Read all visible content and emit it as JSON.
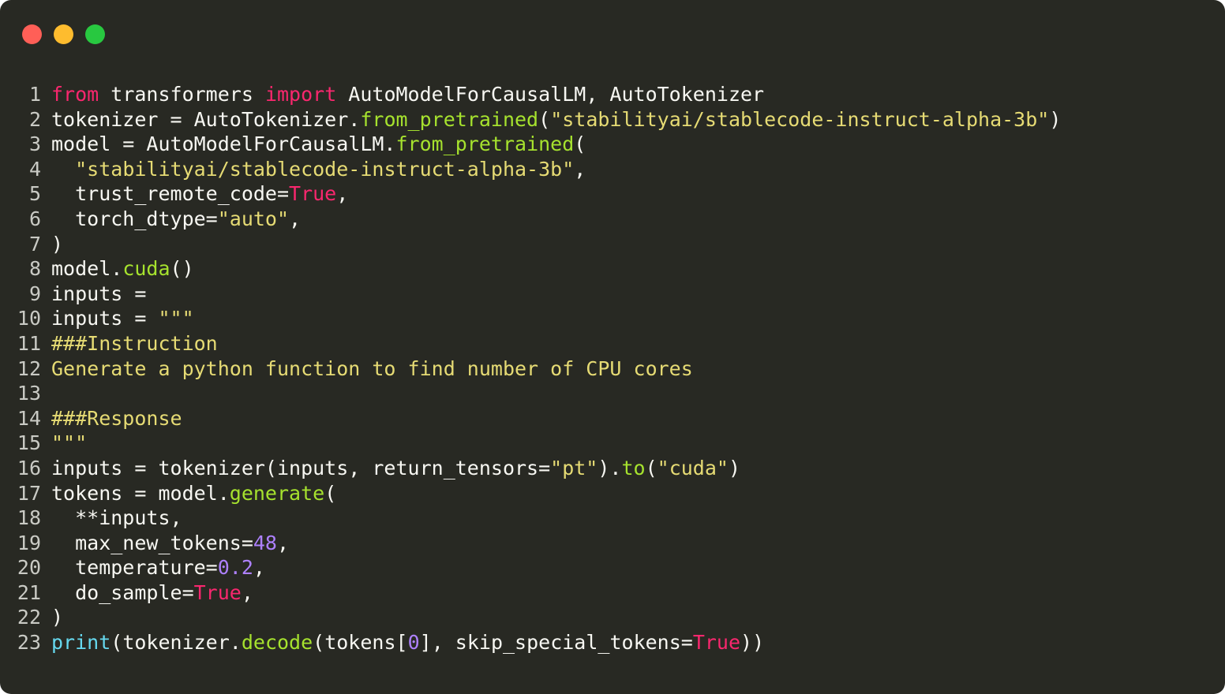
{
  "window": {
    "background_color": "#282923",
    "traffic_lights": [
      {
        "name": "close",
        "color": "#ff5f57"
      },
      {
        "name": "minimize",
        "color": "#febc2e"
      },
      {
        "name": "maximize",
        "color": "#28c840"
      }
    ]
  },
  "theme": {
    "name": "monokai",
    "text_color": "#f7f7f2",
    "gutter_color": "#c9cac4",
    "keyword_color": "#f9276e",
    "function_color": "#a6e22e",
    "string_color": "#e6db74",
    "number_color": "#ae81ff",
    "builtin_color": "#66d9ef"
  },
  "code": {
    "language": "python",
    "first_line_number": 1,
    "total_lines": 23,
    "lines": [
      {
        "n": "1",
        "tokens": [
          {
            "t": "from",
            "c": "kw"
          },
          {
            "t": " transformers ",
            "c": "plain"
          },
          {
            "t": "import",
            "c": "kw"
          },
          {
            "t": " AutoModelForCausalLM, AutoTokenizer",
            "c": "plain"
          }
        ]
      },
      {
        "n": "2",
        "tokens": [
          {
            "t": "tokenizer = AutoTokenizer.",
            "c": "plain"
          },
          {
            "t": "from_pretrained",
            "c": "fn"
          },
          {
            "t": "(",
            "c": "punct"
          },
          {
            "t": "\"stabilityai/stablecode-instruct-alpha-3b\"",
            "c": "str"
          },
          {
            "t": ")",
            "c": "punct"
          }
        ]
      },
      {
        "n": "3",
        "tokens": [
          {
            "t": "model = AutoModelForCausalLM.",
            "c": "plain"
          },
          {
            "t": "from_pretrained",
            "c": "fn"
          },
          {
            "t": "(",
            "c": "punct"
          }
        ]
      },
      {
        "n": "4",
        "tokens": [
          {
            "t": "  ",
            "c": "plain"
          },
          {
            "t": "\"stabilityai/stablecode-instruct-alpha-3b\"",
            "c": "str"
          },
          {
            "t": ",",
            "c": "punct"
          }
        ]
      },
      {
        "n": "5",
        "tokens": [
          {
            "t": "  trust_remote_code=",
            "c": "plain"
          },
          {
            "t": "True",
            "c": "kw"
          },
          {
            "t": ",",
            "c": "punct"
          }
        ]
      },
      {
        "n": "6",
        "tokens": [
          {
            "t": "  torch_dtype=",
            "c": "plain"
          },
          {
            "t": "\"auto\"",
            "c": "str"
          },
          {
            "t": ",",
            "c": "punct"
          }
        ]
      },
      {
        "n": "7",
        "tokens": [
          {
            "t": ")",
            "c": "punct"
          }
        ]
      },
      {
        "n": "8",
        "tokens": [
          {
            "t": "model.",
            "c": "plain"
          },
          {
            "t": "cuda",
            "c": "fn"
          },
          {
            "t": "()",
            "c": "punct"
          }
        ]
      },
      {
        "n": "9",
        "tokens": [
          {
            "t": "inputs = ",
            "c": "plain"
          }
        ]
      },
      {
        "n": "10",
        "tokens": [
          {
            "t": "inputs = ",
            "c": "plain"
          },
          {
            "t": "\"\"\"",
            "c": "str"
          }
        ]
      },
      {
        "n": "11",
        "tokens": [
          {
            "t": "###Instruction",
            "c": "str"
          }
        ]
      },
      {
        "n": "12",
        "tokens": [
          {
            "t": "Generate a python function to find number of CPU cores",
            "c": "str"
          }
        ]
      },
      {
        "n": "13",
        "tokens": [
          {
            "t": "",
            "c": "str"
          }
        ]
      },
      {
        "n": "14",
        "tokens": [
          {
            "t": "###Response",
            "c": "str"
          }
        ]
      },
      {
        "n": "15",
        "tokens": [
          {
            "t": "\"\"\"",
            "c": "str"
          }
        ]
      },
      {
        "n": "16",
        "tokens": [
          {
            "t": "inputs = tokenizer(inputs, return_tensors=",
            "c": "plain"
          },
          {
            "t": "\"pt\"",
            "c": "str"
          },
          {
            "t": ").",
            "c": "punct"
          },
          {
            "t": "to",
            "c": "fn"
          },
          {
            "t": "(",
            "c": "punct"
          },
          {
            "t": "\"cuda\"",
            "c": "str"
          },
          {
            "t": ")",
            "c": "punct"
          }
        ]
      },
      {
        "n": "17",
        "tokens": [
          {
            "t": "tokens = model.",
            "c": "plain"
          },
          {
            "t": "generate",
            "c": "fn"
          },
          {
            "t": "(",
            "c": "punct"
          }
        ]
      },
      {
        "n": "18",
        "tokens": [
          {
            "t": "  **inputs,",
            "c": "plain"
          }
        ]
      },
      {
        "n": "19",
        "tokens": [
          {
            "t": "  max_new_tokens=",
            "c": "plain"
          },
          {
            "t": "48",
            "c": "num"
          },
          {
            "t": ",",
            "c": "punct"
          }
        ]
      },
      {
        "n": "20",
        "tokens": [
          {
            "t": "  temperature=",
            "c": "plain"
          },
          {
            "t": "0.2",
            "c": "num"
          },
          {
            "t": ",",
            "c": "punct"
          }
        ]
      },
      {
        "n": "21",
        "tokens": [
          {
            "t": "  do_sample=",
            "c": "plain"
          },
          {
            "t": "True",
            "c": "kw"
          },
          {
            "t": ",",
            "c": "punct"
          }
        ]
      },
      {
        "n": "22",
        "tokens": [
          {
            "t": ")",
            "c": "punct"
          }
        ]
      },
      {
        "n": "23",
        "tokens": [
          {
            "t": "print",
            "c": "builtin"
          },
          {
            "t": "(tokenizer.",
            "c": "plain"
          },
          {
            "t": "decode",
            "c": "fn"
          },
          {
            "t": "(tokens[",
            "c": "plain"
          },
          {
            "t": "0",
            "c": "num"
          },
          {
            "t": "], skip_special_tokens=",
            "c": "plain"
          },
          {
            "t": "True",
            "c": "kw"
          },
          {
            "t": "))",
            "c": "punct"
          }
        ]
      }
    ]
  }
}
